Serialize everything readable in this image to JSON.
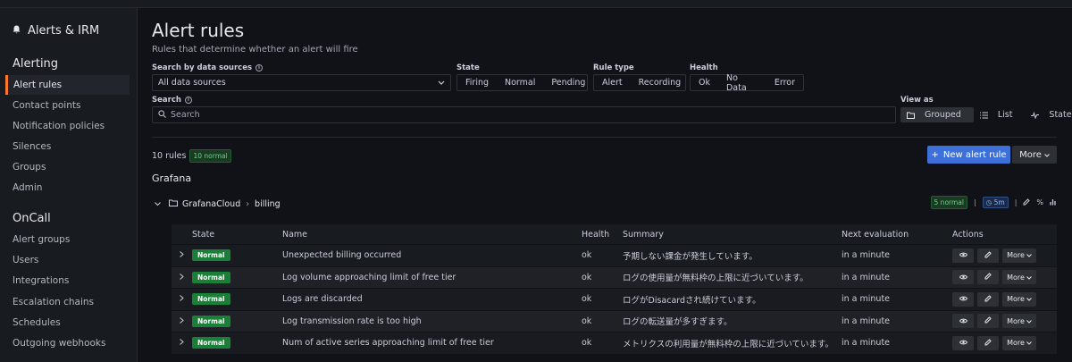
{
  "sidebar": {
    "title": "Alerts & IRM",
    "sections": [
      {
        "heading": "Alerting",
        "items": [
          "Alert rules",
          "Contact points",
          "Notification policies",
          "Silences",
          "Groups",
          "Admin"
        ]
      },
      {
        "heading": "OnCall",
        "items": [
          "Alert groups",
          "Users",
          "Integrations",
          "Escalation chains",
          "Schedules",
          "Outgoing webhooks"
        ]
      }
    ],
    "active_item": "Alert rules"
  },
  "page": {
    "title": "Alert rules",
    "subtitle": "Rules that determine whether an alert will fire"
  },
  "filters": {
    "datasource_label": "Search by data sources",
    "datasource_value": "All data sources",
    "state_label": "State",
    "state_options": [
      "Firing",
      "Normal",
      "Pending"
    ],
    "ruletype_label": "Rule type",
    "ruletype_options": [
      "Alert",
      "Recording"
    ],
    "health_label": "Health",
    "health_options": [
      "Ok",
      "No Data",
      "Error"
    ],
    "search_label": "Search",
    "search_placeholder": "Search",
    "viewas_label": "View as",
    "view_options": [
      "Grouped",
      "List",
      "State"
    ],
    "view_selected": "Grouped"
  },
  "summary": {
    "rules_count": "10 rules",
    "normal_badge": "10 normal",
    "new_rule_label": "New alert rule",
    "more_label": "More"
  },
  "section_name": "Grafana",
  "group": {
    "folder": "GrafanaCloud",
    "name": "billing",
    "normal_badge": "5 normal",
    "interval": "5m"
  },
  "table": {
    "columns": [
      "State",
      "Name",
      "Health",
      "Summary",
      "Next evaluation",
      "Actions"
    ],
    "rows": [
      {
        "state": "Normal",
        "name": "Unexpected billing occurred",
        "health": "ok",
        "summary": "予期しない課金が発生しています。",
        "next": "in a minute"
      },
      {
        "state": "Normal",
        "name": "Log volume approaching limit of free tier",
        "health": "ok",
        "summary": "ログの使用量が無料枠の上限に近づいています。",
        "next": "in a minute"
      },
      {
        "state": "Normal",
        "name": "Logs are discarded",
        "health": "ok",
        "summary": "ログがDisacardされ続けています。",
        "next": "in a minute"
      },
      {
        "state": "Normal",
        "name": "Log transmission rate is too high",
        "health": "ok",
        "summary": "ログの転送量が多すぎます。",
        "next": "in a minute"
      },
      {
        "state": "Normal",
        "name": "Num of active series approaching limit of free tier",
        "health": "ok",
        "summary": "メトリクスの利用量が無料枠の上限に近づいています。",
        "next": "in a minute"
      }
    ],
    "more_label": "More"
  },
  "colors": {
    "accent": "#ff7a28",
    "primary": "#3d71d9",
    "normal": "#1a7f37"
  }
}
